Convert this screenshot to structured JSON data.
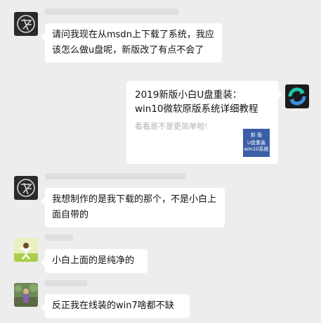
{
  "messages": [
    {
      "text": "请问我现在从msdn上下载了系统，我应该怎么做u盘呢，新版改了有点不会了"
    },
    {
      "card_title": "2019新版小白U盘重装：win10微软原版系统详细教程",
      "card_desc": "看看是不是更简单啦!",
      "thumb_lines": [
        "新 版",
        "U盘重装",
        "win10系统"
      ]
    },
    {
      "text": "我想制作的是我下载的那个，不是小白上面自带的"
    },
    {
      "text": "小白上面的是纯净的"
    },
    {
      "text": "反正我在线装的win7啥都不缺"
    }
  ],
  "colors": {
    "background": "#ededed",
    "bubble": "#ffffff",
    "thumb": "#3b5ea6"
  },
  "icons": [
    "avatar-user-logo",
    "avatar-xiaobai-logo",
    "avatar-person-photo",
    "avatar-outdoor-photo"
  ]
}
